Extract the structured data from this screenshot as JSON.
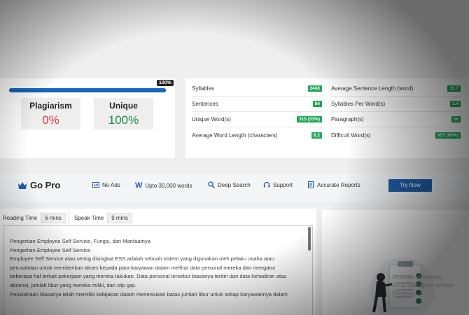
{
  "results": {
    "progress_badge": "100%",
    "progress": 1.0,
    "plagiarism": {
      "label": "Plagiarism",
      "value": "0%"
    },
    "unique": {
      "label": "Unique",
      "value": "100%"
    }
  },
  "stats": {
    "left": [
      {
        "label": "Syllables",
        "value": "2443"
      },
      {
        "label": "Sentences",
        "value": "84"
      },
      {
        "label": "Unique Word(s)",
        "value": "315 (31%)"
      },
      {
        "label": "Average Word Length (characters)",
        "value": "6.2"
      }
    ],
    "right": [
      {
        "label": "Average Sentence Length (word)",
        "value": "15.7"
      },
      {
        "label": "Syllables Per Word(s)",
        "value": "2.4"
      },
      {
        "label": "Paragraph(s)",
        "value": "26"
      },
      {
        "label": "Difficult Word(s)",
        "value": "957 (95%)"
      }
    ]
  },
  "gopro": {
    "title": "Go Pro",
    "features": [
      "No Ads",
      "Upto 30,000 words",
      "Deep Search",
      "Support",
      "Accurate Reports"
    ],
    "cta": "Try Now"
  },
  "reading": {
    "reading_label": "Reading Time",
    "reading_value": "6 mins",
    "speak_label": "Speak Time",
    "speak_value": "9 mins"
  },
  "text_lines": [
    "Pengertian Employee Self Service, Fungsi, dan Manfaatnya",
    "Pengertian Employee Self Service",
    "Employee Self Service atau sering disingkat ESS adalah sebuah sistem yang digunakan oleh pelaku usaha atau",
    "perusahaan untuk memberikan akses kepada para karyawan dalam melihat data personal mereka dan mengatur",
    "beberapa hal terkait pekerjaan yang mereka lakukan. Data personal tersebut biasanya terdiri dari data kehadiran atau",
    "absensi, jumlah libur yang mereka miliki, dan slip gaji.",
    "Perusahaan biasanya telah memiliki kebijakan dalam menentukan batas jumlah libur untuk setiap karyawannya dalam"
  ],
  "watermark": {
    "line1": "Activate Windows",
    "line2": "Go to Settings to activate Windows."
  },
  "colors": {
    "accent": "#1565c0",
    "danger": "#e53935",
    "success": "#1fa855",
    "button": "#1f5fa8"
  }
}
